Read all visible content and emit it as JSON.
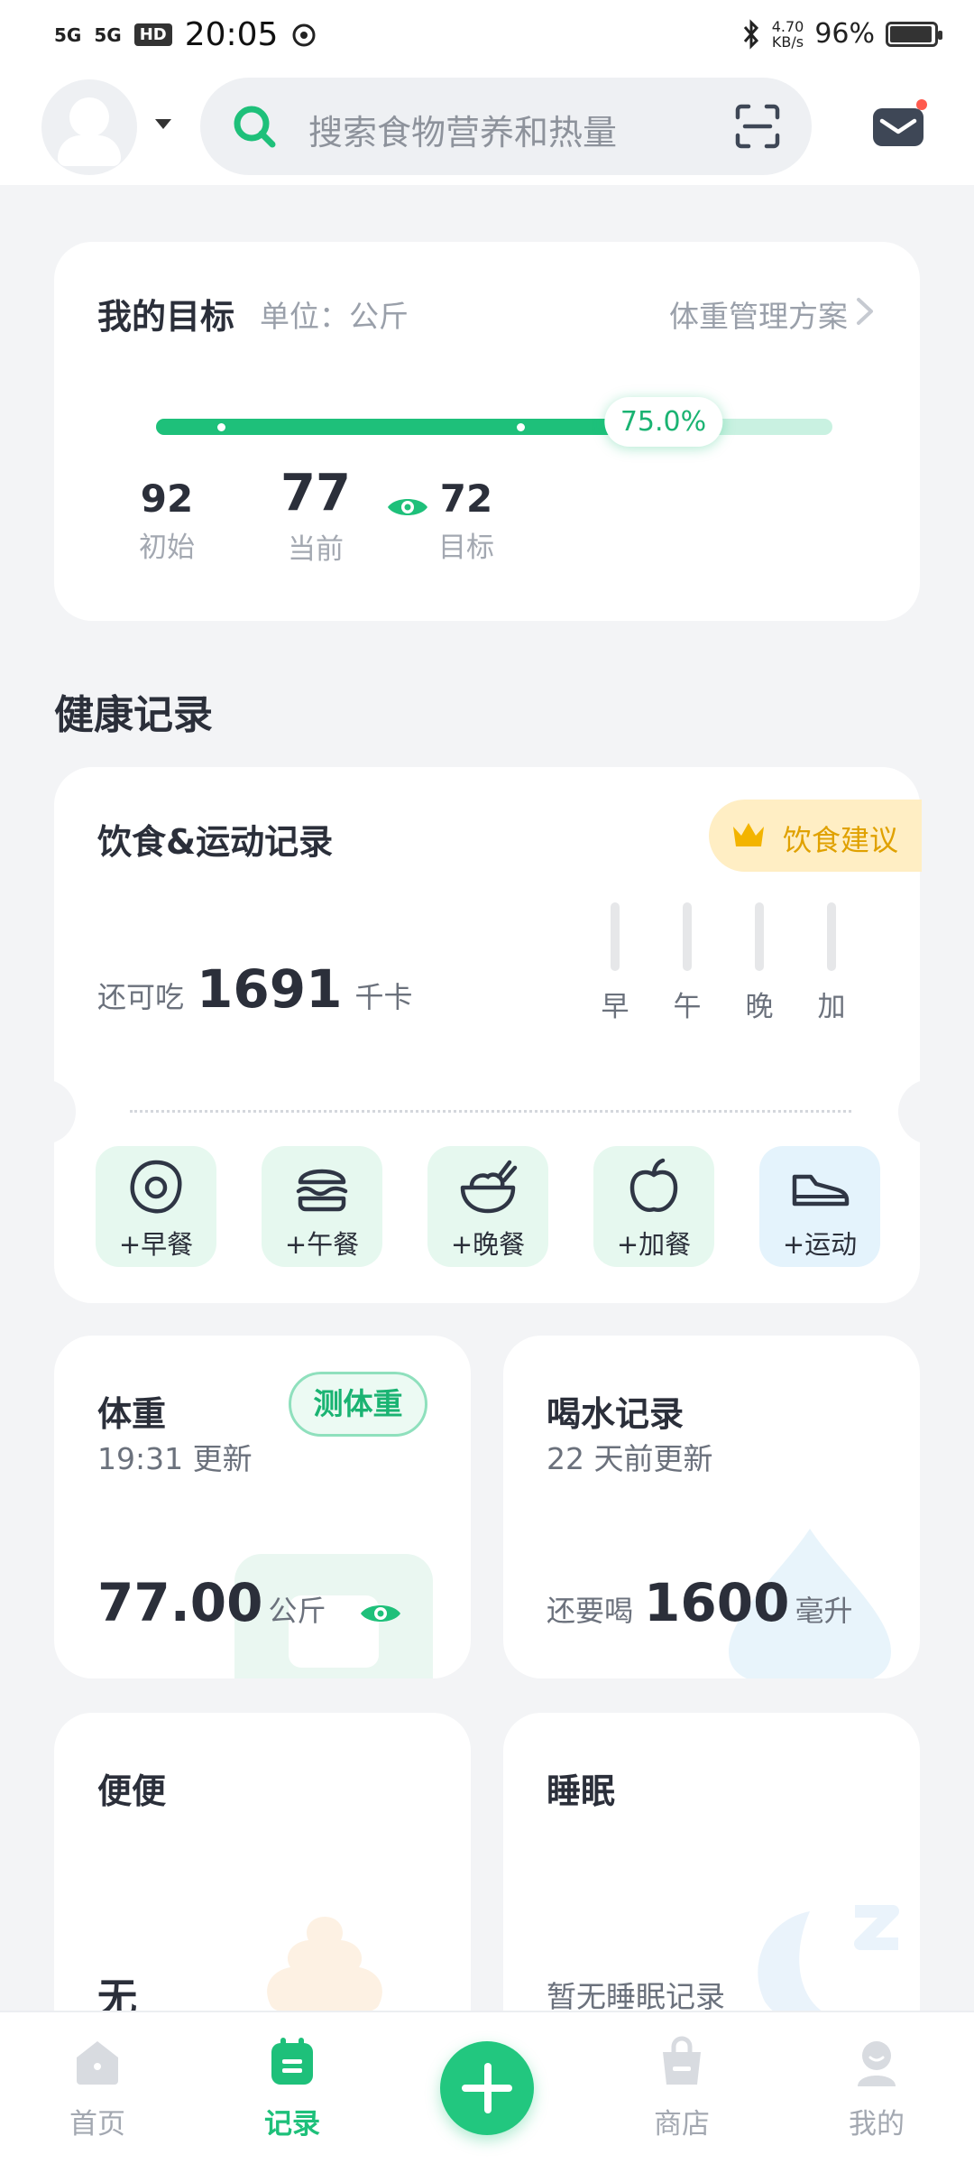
{
  "status_bar": {
    "signal1": "5G",
    "signal2": "5G",
    "hd": "HD",
    "time": "20:05",
    "net_speed": "4.70",
    "net_unit": "KB/s",
    "battery": "96%",
    "battery_level": 0.96
  },
  "header": {
    "search_placeholder": "搜索食物营养和热量"
  },
  "goal": {
    "title": "我的目标",
    "unit": "单位：公斤",
    "plan_link": "体重管理方案",
    "progress_label": "75.0%",
    "progress": 0.75,
    "start_value": "92",
    "start_label": "初始",
    "current_value": "77",
    "current_label": "当前",
    "target_value": "72",
    "target_label": "目标"
  },
  "health_section": {
    "title": "健康记录"
  },
  "diet_card": {
    "title": "饮食&运动记录",
    "advice_label": "饮食建议",
    "remaining_prefix": "还可吃",
    "remaining_value": "1691",
    "remaining_unit": "千卡",
    "meal_bars": [
      {
        "label": "早"
      },
      {
        "label": "午"
      },
      {
        "label": "晚"
      },
      {
        "label": "加"
      }
    ],
    "quick_actions": [
      {
        "label": "+早餐",
        "icon": "fried-egg-icon"
      },
      {
        "label": "+午餐",
        "icon": "burger-icon"
      },
      {
        "label": "+晚餐",
        "icon": "bowl-icon"
      },
      {
        "label": "+加餐",
        "icon": "apple-icon"
      },
      {
        "label": "+运动",
        "icon": "sneaker-icon"
      }
    ]
  },
  "weight_card": {
    "title": "体重",
    "updated": "19:31 更新",
    "measure_button": "测体重",
    "value": "77.00",
    "unit": "公斤"
  },
  "water_card": {
    "title": "喝水记录",
    "updated": "22 天前更新",
    "prefix": "还要喝",
    "value": "1600",
    "unit": "毫升"
  },
  "poop_card": {
    "title": "便便",
    "value": "无"
  },
  "sleep_card": {
    "title": "睡眠",
    "value": "暂无睡眠记录"
  },
  "bottom_nav": {
    "items": [
      {
        "label": "首页",
        "icon": "home-icon"
      },
      {
        "label": "记录",
        "icon": "record-icon"
      },
      {
        "label": "商店",
        "icon": "shop-icon"
      },
      {
        "label": "我的",
        "icon": "profile-icon"
      }
    ]
  },
  "colors": {
    "accent": "#1ec07a",
    "accent_light": "#c9f1e1",
    "advice_bg": "#ffeec4",
    "advice_text": "#e0a100"
  }
}
